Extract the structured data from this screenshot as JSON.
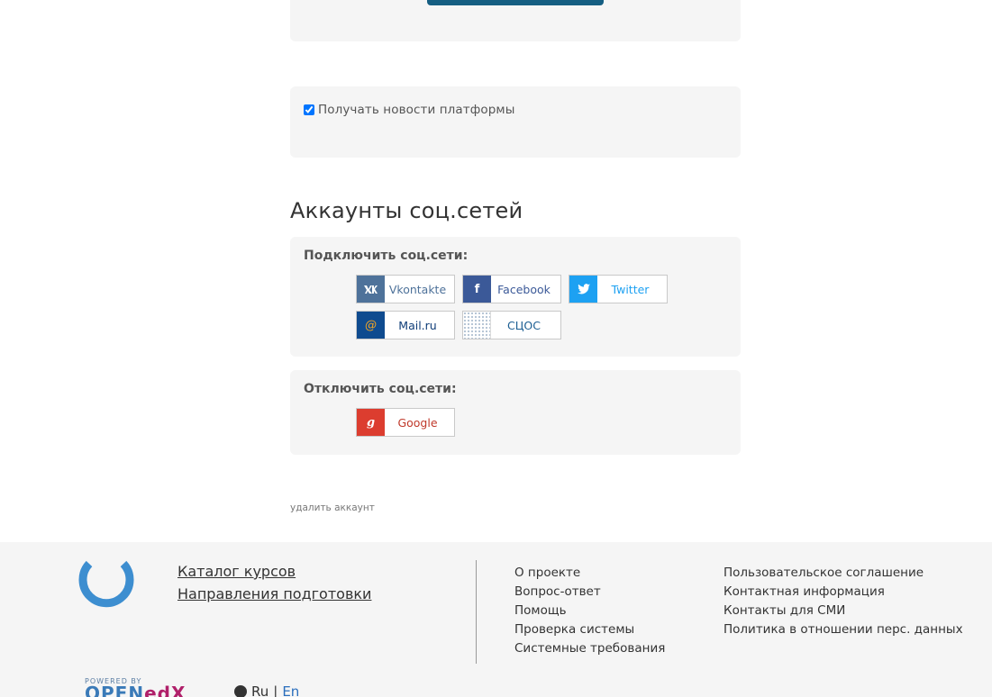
{
  "newsletter": {
    "checked": true,
    "label": "Получать новости платформы"
  },
  "social_section": {
    "title": "Аккаунты соц.сетей",
    "connect_heading": "Подключить соц.сети:",
    "connect_buttons": [
      {
        "label": "Vkontakte",
        "icon": "vk-icon",
        "color": "#4e729a"
      },
      {
        "label": "Facebook",
        "icon": "facebook-icon",
        "color": "#3b5998"
      },
      {
        "label": "Twitter",
        "icon": "twitter-icon",
        "color": "#1da1f2"
      },
      {
        "label": "Mail.ru",
        "icon": "mailru-icon",
        "color": "#0f4b8f"
      },
      {
        "label": "СЦОС",
        "icon": "scos-icon",
        "color": "#1d5f93"
      }
    ],
    "disconnect_heading": "Отключить соц.сети:",
    "disconnect_buttons": [
      {
        "label": "Google",
        "icon": "google-icon",
        "color": "#dc3d2f"
      }
    ]
  },
  "delete_account": "удалить аккаунт",
  "footer": {
    "catalog_links": [
      "Каталог курсов",
      "Направления подготовки"
    ],
    "col1": [
      "О проекте",
      "Вопрос-ответ",
      "Помощь",
      "Проверка системы",
      "Системные требования"
    ],
    "col2": [
      "Пользовательское соглашение",
      "Контактная информация",
      "Контакты для СМИ",
      "Политика в отношении перс. данных"
    ],
    "powered_by": "POWERED BY",
    "powered_open": "OPEN",
    "powered_edx": "edX",
    "lang_ru": "Ru",
    "lang_sep": "|",
    "lang_en": "En"
  }
}
